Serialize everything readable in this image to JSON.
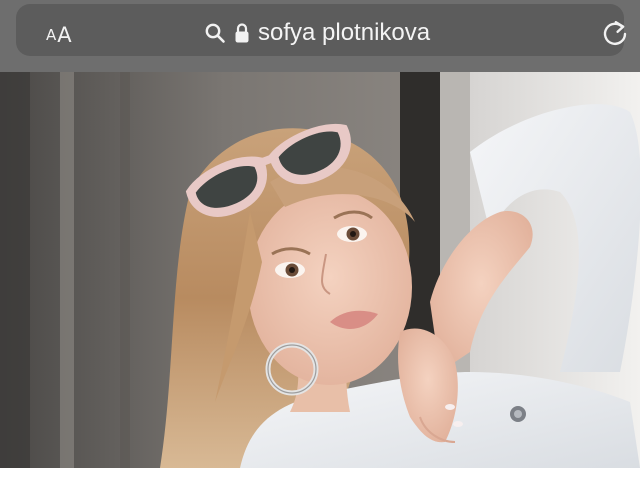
{
  "browser": {
    "reader_small": "A",
    "reader_big": "A",
    "address_text": "sofya plotnikova",
    "icons": {
      "reader": "text-size-icon",
      "search": "search-icon",
      "lock": "lock-icon",
      "reload": "reload-icon"
    }
  },
  "colors": {
    "chrome": "#6e6e6e",
    "address_pill": "#5c5c5c",
    "address_text": "#f4f4f4"
  }
}
